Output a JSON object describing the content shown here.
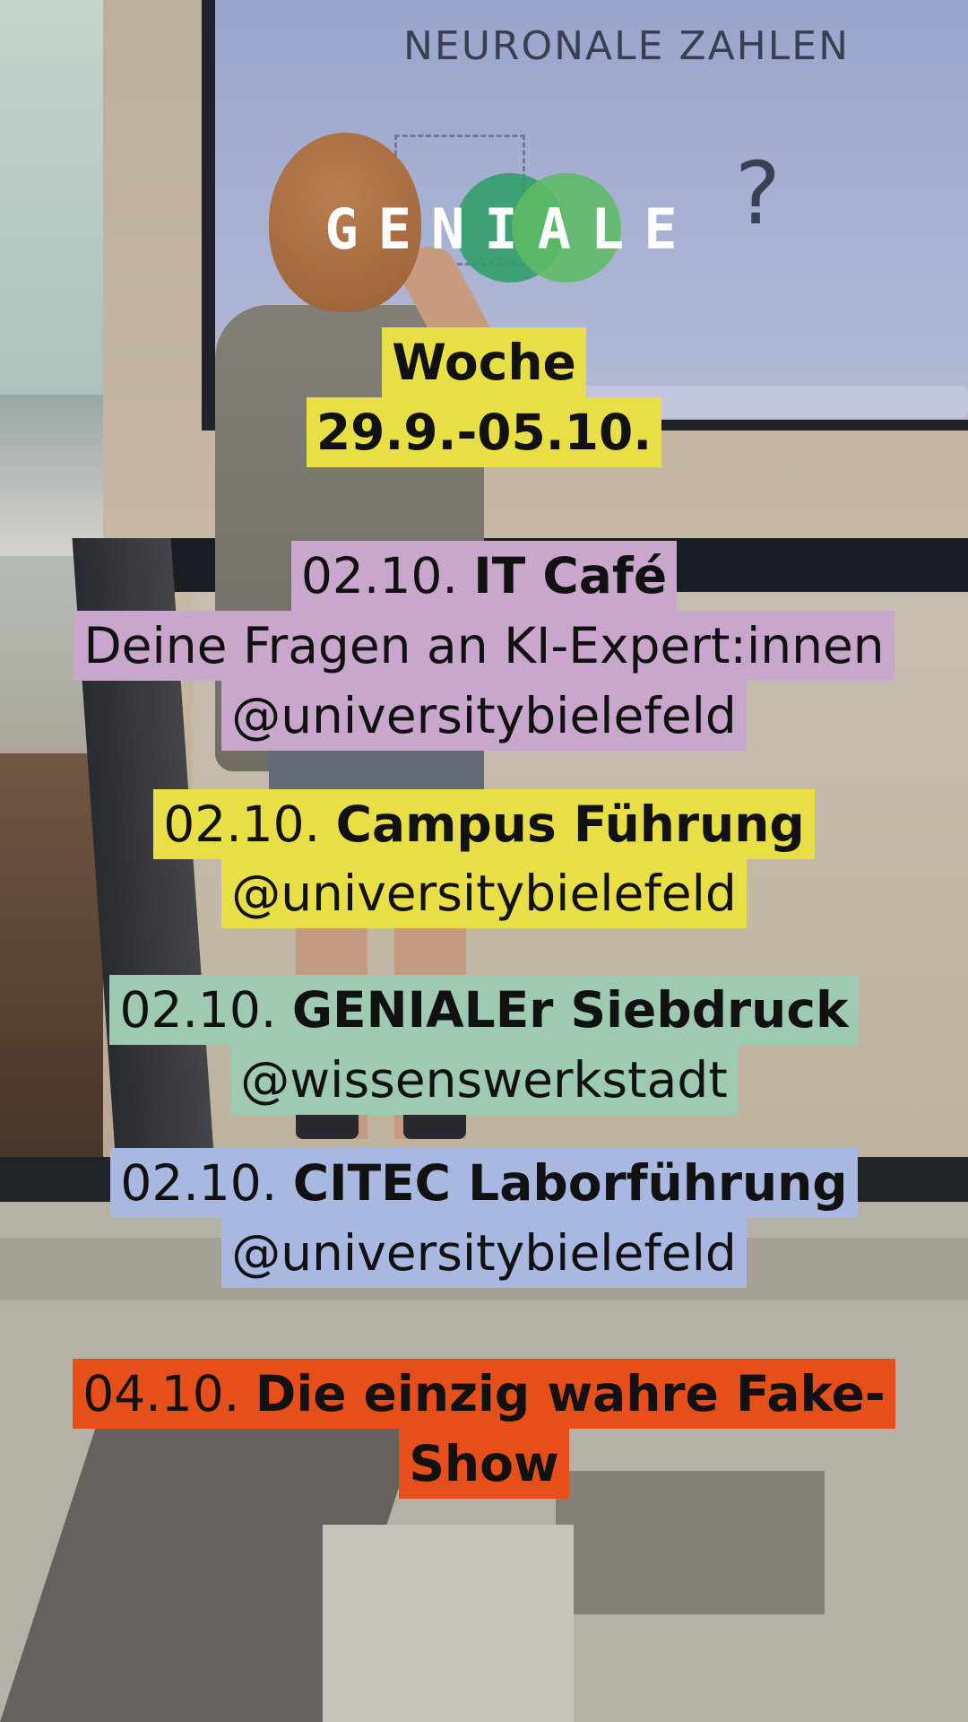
{
  "brand": {
    "logo_text": "GENIALE",
    "colors": {
      "green_dark": "#2f9e68",
      "green_light": "#5dbb63"
    }
  },
  "background": {
    "screen_title": "NEURONALE ZAHLEN",
    "screen_symbol": "?"
  },
  "week": {
    "label": "Woche",
    "range": "29.9.-05.10.",
    "color": "#e8df46"
  },
  "events": [
    {
      "date": "02.10.",
      "title": "IT Café",
      "subtitle": "Deine Fragen an KI-Expert:innen",
      "handle": "@universitybielefeld",
      "color": "#c9a6cb"
    },
    {
      "date": "02.10.",
      "title": "Campus Führung",
      "handle": "@universitybielefeld",
      "color": "#e8df46"
    },
    {
      "date": "02.10.",
      "title": "GENIALEr Siebdruck",
      "handle": "@wissenswerkstadt",
      "color": "#9fcab2"
    },
    {
      "date": "02.10.",
      "title": "CITEC Laborführung",
      "handle": "@universitybielefeld",
      "color": "#a8b8e0"
    },
    {
      "date": "04.10.",
      "title_line1": "Die einzig wahre Fake-",
      "title_line2": "Show",
      "color": "#e64f19"
    }
  ]
}
